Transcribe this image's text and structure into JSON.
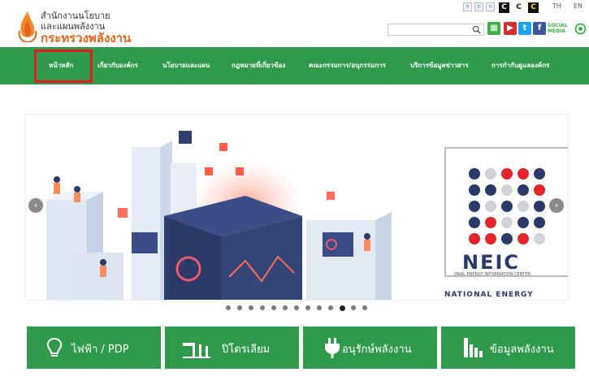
{
  "header": {
    "logo_line1": "สำนักงานนโยบาย",
    "logo_line2": "และแผนพลังงาน",
    "logo_line3": "กระทรวงพลังงาน",
    "font_sizes": [
      "ก",
      "ก",
      "ก"
    ],
    "contrast": [
      "C",
      "C",
      "C"
    ],
    "languages": [
      "TH",
      "EN"
    ],
    "social_media_label_line1": "SOCIAL",
    "social_media_label_line2": "MEDIA"
  },
  "nav": {
    "items": [
      "หน้าหลัก",
      "เกี่ยวกับองค์กร",
      "นโยบายและแผน",
      "กฎหมายที่เกี่ยวข้อง",
      "คณะกรรมการ/อนุกรรมการ",
      "บริการข้อมูลข่าวสาร",
      "การกำกับดูแลองค์กร"
    ]
  },
  "slider": {
    "badge_text": "NEIC",
    "badge_caption": "ONAL ENERGY INFORMATION CENTER",
    "bottom_text": "NATIONAL ENERGY",
    "slide_count": 13,
    "active_slide": 10
  },
  "categories": [
    {
      "label": "ไฟฟ้า / PDP",
      "icon": "bulb-icon"
    },
    {
      "label": "ปิโตรเลียม",
      "icon": "oil-pump-icon"
    },
    {
      "label": "อนุรักษ์พลังงาน",
      "icon": "plug-icon"
    },
    {
      "label": "ข้อมูลพลังงาน",
      "icon": "building-chart-icon"
    }
  ],
  "colors": {
    "brand_green": "#2f9a4a",
    "brand_orange": "#e8631a",
    "highlight_red": "#e02020"
  }
}
